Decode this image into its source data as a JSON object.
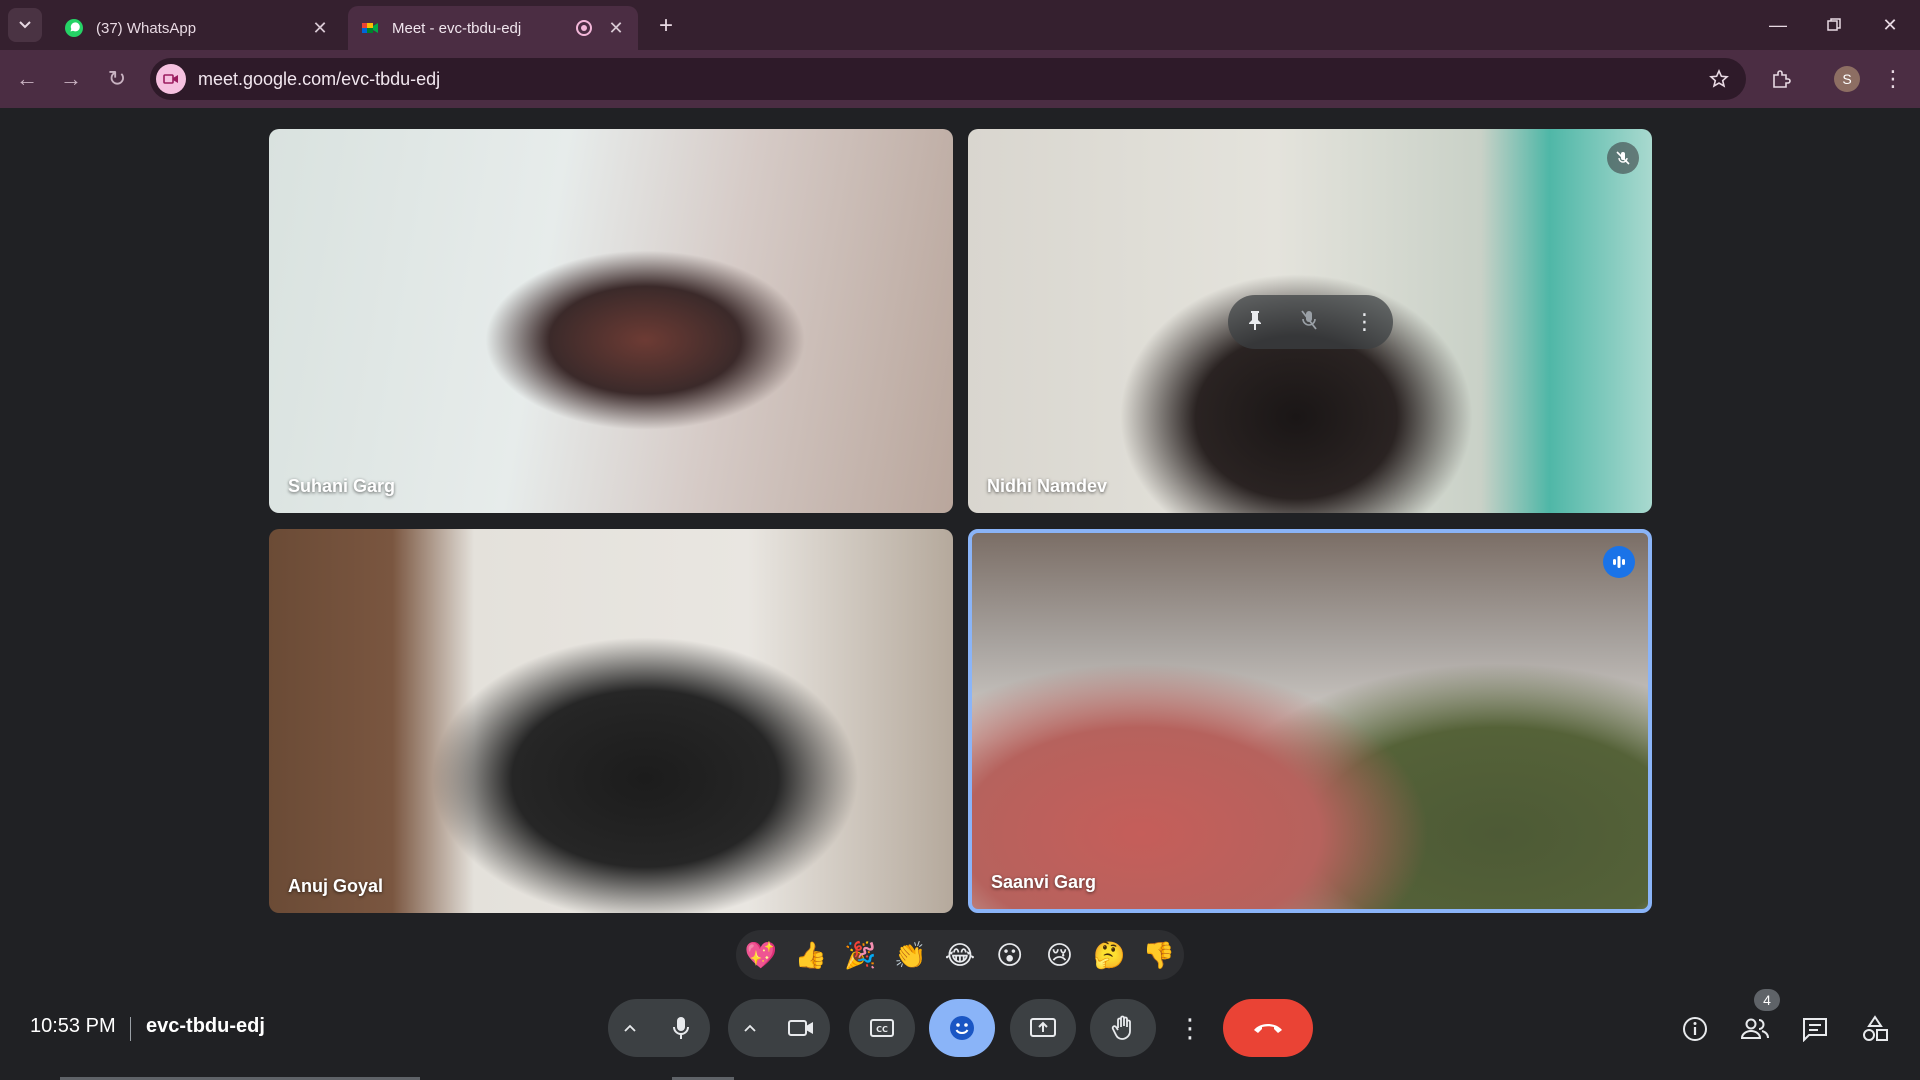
{
  "browser": {
    "tabs": [
      {
        "title": "(37) WhatsApp",
        "active": false
      },
      {
        "title": "Meet - evc-tbdu-edj",
        "active": true
      }
    ],
    "url": "meet.google.com/evc-tbdu-edj",
    "profile_initial": "S"
  },
  "meet": {
    "participants": [
      {
        "name": "Suhani Garg",
        "state": "normal"
      },
      {
        "name": "Nidhi Namdev",
        "state": "muted"
      },
      {
        "name": "Anuj Goyal",
        "state": "normal"
      },
      {
        "name": "Saanvi Garg",
        "state": "speaking"
      }
    ],
    "reactions": [
      "💖",
      "👍",
      "🎉",
      "👏",
      "😂",
      "😮",
      "😢",
      "🤔",
      "👎"
    ],
    "time": "10:53 PM",
    "meeting_code": "evc-tbdu-edj",
    "people_count": "4"
  },
  "colors": {
    "accent": "#8ab4f8",
    "end_call": "#ea4335",
    "speaking": "#1a73e8"
  }
}
